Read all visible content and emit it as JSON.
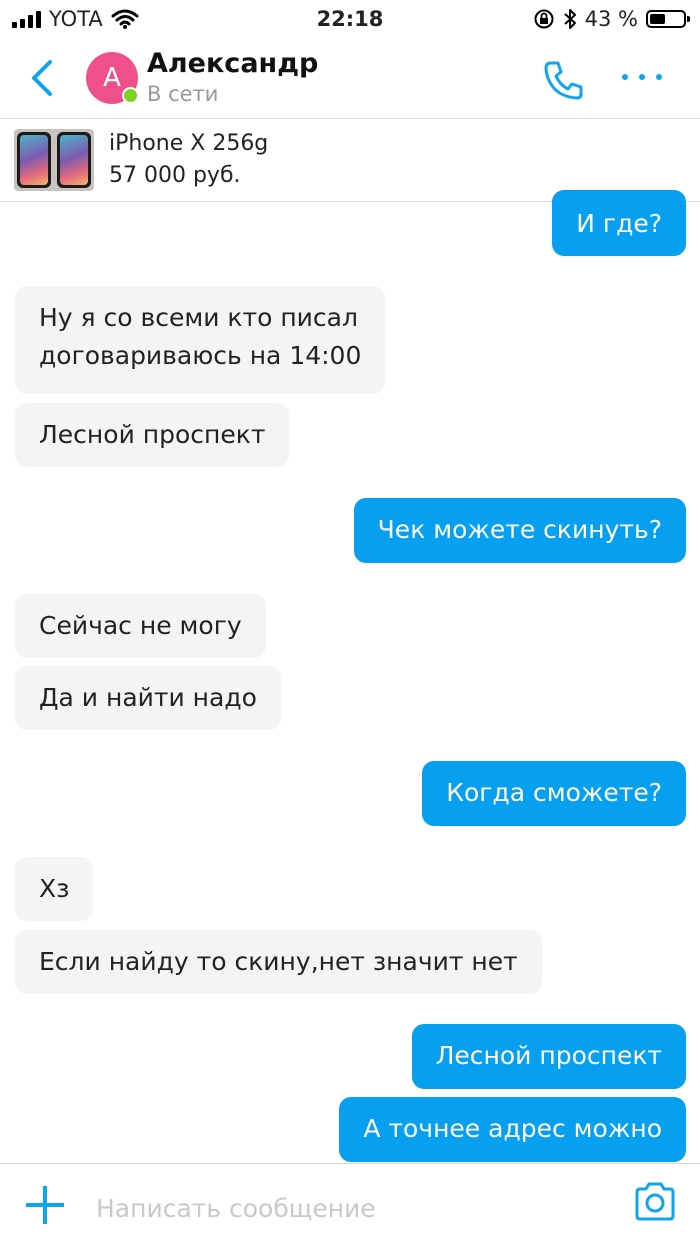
{
  "status_bar": {
    "carrier": "YOTA",
    "time": "22:18",
    "battery": "43 %",
    "battery_level": 0.43
  },
  "header": {
    "avatar_letter": "А",
    "contact_name": "Александр",
    "presence": "В сети",
    "accent_color": "#0ea4ef"
  },
  "product": {
    "title": "iPhone X 256g",
    "price": "57 000 руб."
  },
  "messages": [
    {
      "direction": "outgoing",
      "text": "И где?"
    },
    {
      "direction": "incoming",
      "lines": [
        "Ну я со всеми кто писал",
        "договариваюсь на 14:00"
      ]
    },
    {
      "direction": "incoming",
      "text": "Лесной проспект"
    },
    {
      "direction": "outgoing",
      "text": "Чек можете скинуть?"
    },
    {
      "direction": "incoming",
      "text": "Сейчас не могу"
    },
    {
      "direction": "incoming",
      "text": "Да и найти надо"
    },
    {
      "direction": "outgoing",
      "text": "Когда сможете?"
    },
    {
      "direction": "incoming",
      "text": "Хз"
    },
    {
      "direction": "incoming",
      "text": "Если найду то скину,нет значит нет"
    },
    {
      "direction": "outgoing",
      "text": "Лесной проспект"
    },
    {
      "direction": "outgoing",
      "text": "А точнее адрес можно"
    }
  ],
  "composer": {
    "placeholder": "Написать сообщение",
    "value": ""
  },
  "colors": {
    "outgoing_bubble": "#079ff0",
    "incoming_bubble": "#f4f4f4",
    "online_dot": "#7ed321",
    "avatar": "#f0508a"
  }
}
